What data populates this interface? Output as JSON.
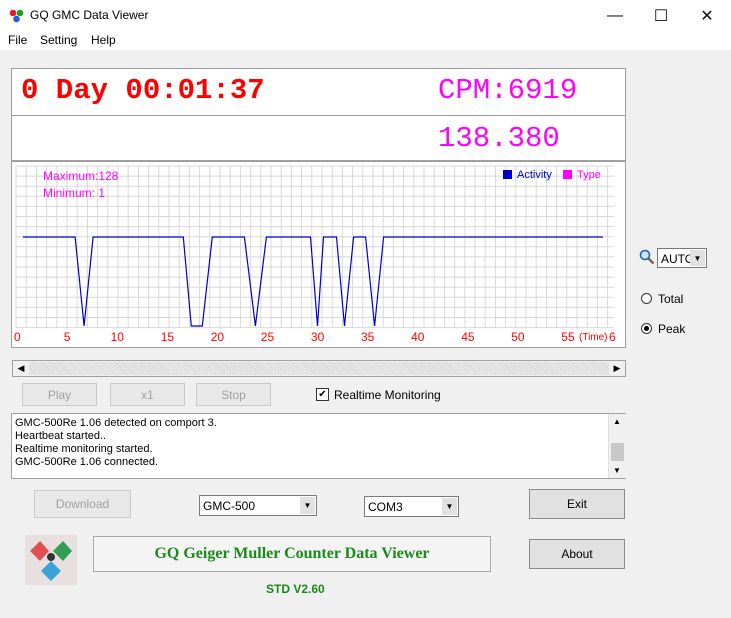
{
  "window": {
    "title": "GQ GMC Data Viewer",
    "minimize": "—",
    "maximize": "☐",
    "close": "✕"
  },
  "menu": {
    "file": "File",
    "setting": "Setting",
    "help": "Help"
  },
  "display": {
    "time": "0 Day 00:01:37",
    "cpm": "CPM:6919",
    "dose": "138.380"
  },
  "chart": {
    "max_label": "Maximum:128",
    "min_label": "Minimum: 1",
    "legend_activity": "Activity",
    "legend_type": "Type",
    "x_ticks": [
      "0",
      "5",
      "10",
      "15",
      "20",
      "25",
      "30",
      "35",
      "40",
      "45",
      "50",
      "55"
    ],
    "x_unit": "(Time)",
    "x_last": "6"
  },
  "chart_data": {
    "type": "line",
    "title": "",
    "xlabel": "(Time)",
    "ylabel": "",
    "xlim": [
      0,
      60
    ],
    "ylim": [
      1,
      128
    ],
    "grid": true,
    "legend_position": "top-right",
    "x_tick_labels": [
      "0",
      "5",
      "10",
      "15",
      "20",
      "25",
      "30",
      "35",
      "40",
      "45",
      "50",
      "55",
      "6"
    ],
    "series": [
      {
        "name": "Activity",
        "color": "#0000cc",
        "points": [
          [
            0.6,
            128
          ],
          [
            5.8,
            128
          ],
          [
            6.7,
            1
          ],
          [
            7.6,
            128
          ],
          [
            16.6,
            128
          ],
          [
            17.4,
            1
          ],
          [
            18.5,
            1
          ],
          [
            19.5,
            128
          ],
          [
            22.7,
            128
          ],
          [
            23.8,
            1
          ],
          [
            24.9,
            128
          ],
          [
            29.3,
            128
          ],
          [
            30.0,
            1
          ],
          [
            30.6,
            128
          ],
          [
            31.9,
            128
          ],
          [
            32.7,
            1
          ],
          [
            33.6,
            128
          ],
          [
            34.8,
            128
          ],
          [
            35.7,
            1
          ],
          [
            36.6,
            128
          ],
          [
            58.5,
            128
          ]
        ]
      }
    ],
    "colors": {
      "activity": "#0000cc",
      "type": "#ff00ff",
      "labels": "#ff0000"
    }
  },
  "zoom": {
    "value": "AUTO"
  },
  "options": {
    "total_label": "Total",
    "peak_label": "Peak",
    "selected": "Peak"
  },
  "controls": {
    "play": "Play",
    "speed": "x1",
    "stop": "Stop",
    "realtime_label": "Realtime Monitoring",
    "realtime_checked": "✔"
  },
  "log": [
    "GMC-500Re 1.06 detected on comport 3.",
    "Heartbeat started..",
    "Realtime monitoring started.",
    "GMC-500Re 1.06 connected."
  ],
  "bottom": {
    "download": "Download",
    "model": "GMC-500",
    "port": "COM3",
    "exit": "Exit",
    "about": "About",
    "banner": "GQ Geiger Muller Counter Data Viewer",
    "version": "STD V2.60"
  }
}
